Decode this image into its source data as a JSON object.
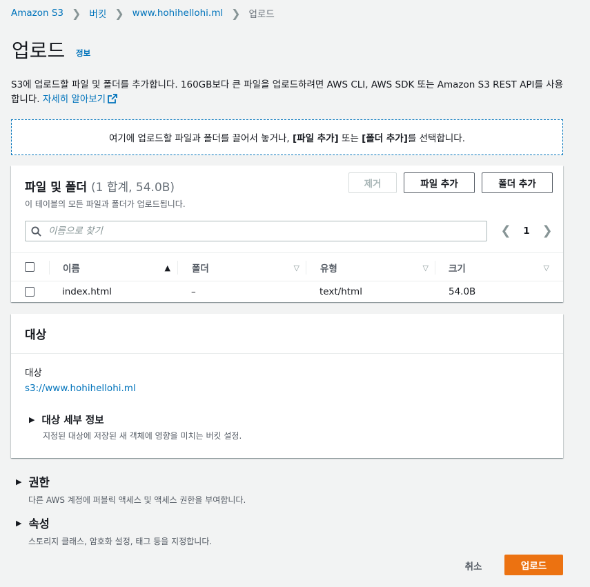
{
  "breadcrumb": {
    "items": [
      "Amazon S3",
      "버킷",
      "www.hohihellohi.ml",
      "업로드"
    ]
  },
  "page": {
    "title": "업로드",
    "info_link": "정보",
    "description": "S3에 업로드할 파일 및 폴더를 추가합니다. 160GB보다 큰 파일을 업로드하려면 AWS CLI, AWS SDK 또는 Amazon S3 REST API를 사용합니다.",
    "learn_more": "자세히 알아보기"
  },
  "dropzone": {
    "text_before": "여기에 업로드할 파일과 폴더를 끌어서 놓거나, ",
    "add_files": "[파일 추가]",
    "middle": " 또는 ",
    "add_folder": "[폴더 추가]",
    "text_after": "를 선택합니다."
  },
  "files_panel": {
    "title": "파일 및 폴더",
    "count": "(1 합계, 54.0B)",
    "subtitle": "이 테이블의 모든 파일과 폴더가 업로드됩니다.",
    "remove_label": "제거",
    "add_files_label": "파일 추가",
    "add_folder_label": "폴더 추가",
    "search_placeholder": "이름으로 찾기",
    "page_number": "1",
    "columns": [
      "이름",
      "폴더",
      "유형",
      "크기"
    ],
    "rows": [
      {
        "name": "index.html",
        "folder": "–",
        "type": "text/html",
        "size": "54.0B"
      }
    ]
  },
  "destination": {
    "title": "대상",
    "label": "대상",
    "link": "s3://www.hohihellohi.ml",
    "details_title": "대상 세부 정보",
    "details_sub": "지정된 대상에 저장된 새 객체에 영향을 미치는 버킷 설정."
  },
  "permissions": {
    "title": "권한",
    "sub": "다른 AWS 계정에 퍼블릭 액세스 및 액세스 권한을 부여합니다."
  },
  "properties": {
    "title": "속성",
    "sub": "스토리지 클래스, 암호화 설정, 태그 등을 지정합니다."
  },
  "footer": {
    "cancel_label": "취소",
    "upload_label": "업로드"
  },
  "colors": {
    "link": "#0073bb",
    "primary_button": "#ec7211",
    "background": "#f2f3f3"
  }
}
